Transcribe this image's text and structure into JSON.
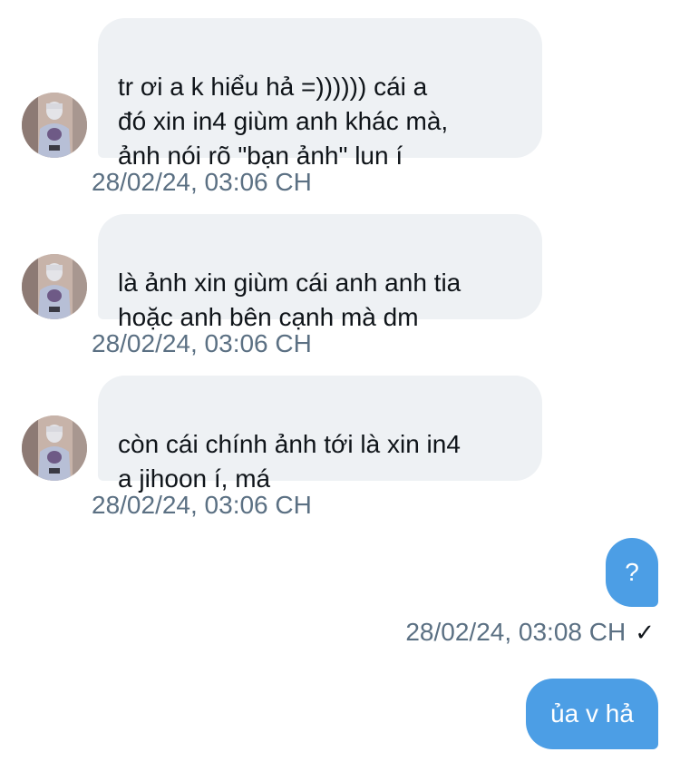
{
  "messages_in": [
    {
      "text": " tr ơi a k hiểu hả =)))))) cái a\nđó xin in4 giùm anh khác mà,\nảnh nói rõ \"bạn ảnh\" lun í",
      "timestamp": "28/02/24, 03:06 CH"
    },
    {
      "text": "là ảnh xin giùm cái anh anh tia\nhoặc anh bên cạnh mà dm",
      "timestamp": "28/02/24, 03:06 CH"
    },
    {
      "text": "còn cái chính ảnh tới là xin in4\na jihoon í, má",
      "timestamp": "28/02/24, 03:06 CH"
    }
  ],
  "messages_out": [
    {
      "text": "?",
      "timestamp": "28/02/24, 03:08 CH",
      "status_icon": "check-icon"
    },
    {
      "text": "ủa v hả"
    }
  ],
  "colors": {
    "incoming_bubble": "#eef1f4",
    "outgoing_bubble": "#4c9ee5",
    "timestamp": "#5b7083",
    "text": "#0f1419"
  }
}
